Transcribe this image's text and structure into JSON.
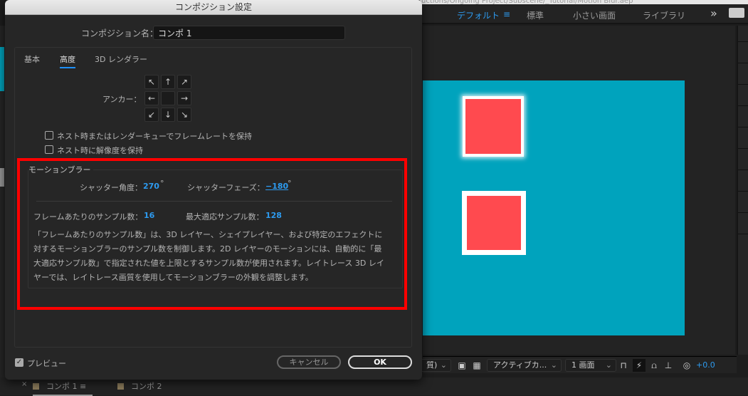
{
  "app": {
    "path_title": "uctions/Ongoing Project/Subscene/_Tutorial/Motion Blur.aep",
    "workspaces": [
      "デフォルト",
      "標準",
      "小さい画面",
      "ライブラリ"
    ],
    "workspace_menu_icon": "≡",
    "overflow_icon": "»",
    "viewer_toolbar": {
      "quality": "質)",
      "camera": "アクティブカ...",
      "views": "1 画面",
      "exposure": "+0.0"
    },
    "comp_tabs": [
      {
        "label": "コンポ 1",
        "active": true
      },
      {
        "label": "コンポ 2",
        "active": false
      }
    ],
    "colors": {
      "accent": "#2d9bf0",
      "teal": "#00a3bd",
      "square": "#ff4a4f",
      "highlight": "#ff0000"
    }
  },
  "dialog": {
    "title": "コンポジション設定",
    "name_label": "コンポジション名：",
    "name_value": "コンポ 1",
    "tabs": [
      "基本",
      "高度",
      "3D レンダラー"
    ],
    "active_tab": "高度",
    "anchor_label": "アンカー：",
    "checkboxes": [
      {
        "label": "ネスト時またはレンダーキューでフレームレートを保持",
        "checked": false
      },
      {
        "label": "ネスト時に解像度を保持",
        "checked": false
      }
    ],
    "motion_blur": {
      "title": "モーションブラー",
      "shutter_angle_label": "シャッター角度：",
      "shutter_angle": "270",
      "shutter_phase_label": "シャッターフェーズ：",
      "shutter_phase": "−180",
      "degree": "°",
      "samples_label": "フレームあたりのサンプル数：",
      "samples": "16",
      "adaptive_label": "最大適応サンプル数：",
      "adaptive": "128",
      "description": "「フレームあたりのサンプル数」は、3D レイヤー、シェイプレイヤー、および特定のエフェクトに対するモーションブラーのサンプル数を制御します。2D レイヤーのモーションには、自動的に「最大適応サンプル数」で指定された値を上限とするサンプル数が使用されます。レイトレース 3D レイヤーでは、レイトレース画質を使用してモーションブラーの外観を調整します。"
    },
    "preview_label": "プレビュー",
    "preview_checked": true,
    "cancel_label": "キャンセル",
    "ok_label": "OK"
  }
}
